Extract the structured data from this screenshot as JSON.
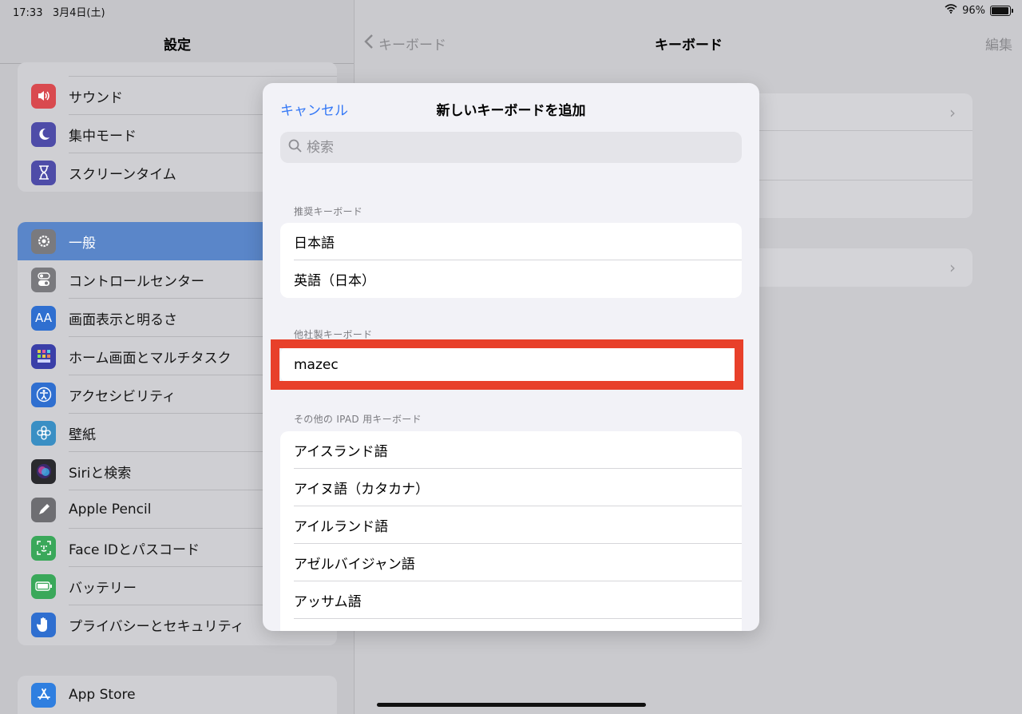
{
  "status_bar": {
    "time": "17:33",
    "date": "3月4日(土)",
    "battery": "96%",
    "battery_level": 0.96
  },
  "sidebar": {
    "title": "設定",
    "group1": [
      {
        "label": "サウンド",
        "icon": "speaker-icon",
        "color": "#d94a4f"
      },
      {
        "label": "集中モード",
        "icon": "moon-icon",
        "color": "#4e4ca8"
      },
      {
        "label": "スクリーンタイム",
        "icon": "hourglass-icon",
        "color": "#4e4ca8"
      }
    ],
    "group2": [
      {
        "label": "一般",
        "icon": "gear-icon",
        "color": "#7a7a7e"
      },
      {
        "label": "コントロールセンター",
        "icon": "toggles-icon",
        "color": "#7a7a7e"
      },
      {
        "label": "画面表示と明るさ",
        "icon": "text-size-icon",
        "color": "#2f6fd0"
      },
      {
        "label": "ホーム画面とマルチタスク",
        "icon": "grid-icon",
        "color": "#3a3fa8"
      },
      {
        "label": "アクセシビリティ",
        "icon": "accessibility-icon",
        "color": "#2f6fd0"
      },
      {
        "label": "壁紙",
        "icon": "flower-icon",
        "color": "#3a8fc4"
      },
      {
        "label": "Siriと検索",
        "icon": "siri-icon",
        "color": "#2a2a2e"
      },
      {
        "label": "Apple Pencil",
        "icon": "pencil-icon",
        "color": "#6e6e72"
      },
      {
        "label": "Face IDとパスコード",
        "icon": "face-id-icon",
        "color": "#3aa85a"
      },
      {
        "label": "バッテリー",
        "icon": "battery-icon",
        "color": "#3aa85a"
      },
      {
        "label": "プライバシーとセキュリティ",
        "icon": "hand-icon",
        "color": "#2f6fd0"
      }
    ],
    "group3": [
      {
        "label": "App Store",
        "icon": "app-store-icon",
        "color": "#2f7fe0"
      }
    ]
  },
  "detail": {
    "back": "キーボード",
    "title": "キーボード",
    "edit": "編集"
  },
  "modal": {
    "cancel": "キャンセル",
    "title": "新しいキーボードを追加",
    "search_placeholder": "検索",
    "sections": {
      "recommended": {
        "header": "推奨キーボード",
        "items": [
          "日本語",
          "英語（日本）"
        ]
      },
      "third_party": {
        "header": "他社製キーボード",
        "items": [
          "mazec"
        ]
      },
      "other": {
        "header": "その他の IPAD 用キーボード",
        "items": [
          "アイスランド語",
          "アイヌ語（カタカナ）",
          "アイルランド語",
          "アゼルバイジャン語",
          "アッサム語"
        ]
      }
    }
  },
  "colors": {
    "accent": "#3478f6",
    "highlight": "#e8402a",
    "selected_row": "#5a86c9"
  }
}
